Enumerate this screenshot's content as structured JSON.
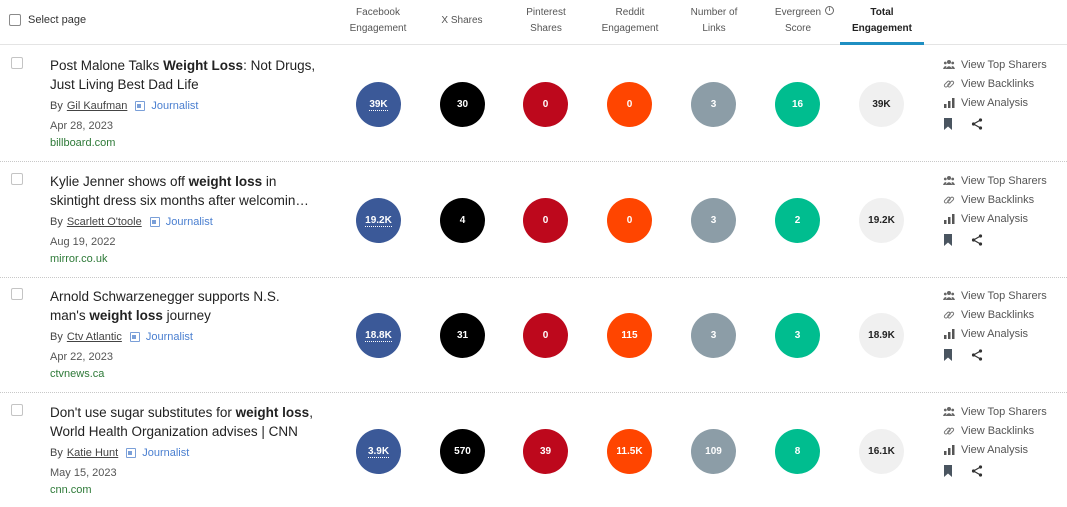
{
  "header": {
    "select_page_label": "Select page",
    "columns": [
      {
        "line1": "Facebook",
        "line2": "Engagement"
      },
      {
        "line1": "X Shares",
        "line2": ""
      },
      {
        "line1": "Pinterest",
        "line2": "Shares"
      },
      {
        "line1": "Reddit",
        "line2": "Engagement"
      },
      {
        "line1": "Number of",
        "line2": "Links"
      },
      {
        "line1": "Evergreen",
        "line2": "Score",
        "info_icon": "info-icon"
      },
      {
        "line1": "Total",
        "line2": "Engagement",
        "active": true
      }
    ]
  },
  "actions": {
    "top_sharers": "View Top Sharers",
    "backlinks": "View Backlinks",
    "analysis": "View Analysis",
    "icons": [
      "users-icon",
      "link-icon",
      "bar-chart-icon",
      "bookmark-icon",
      "share-icon"
    ]
  },
  "colors": {
    "facebook": "#3b5998",
    "x": "#000000",
    "pinterest": "#bd081c",
    "reddit": "#ff4500",
    "links": "#8c9da7",
    "evergreen": "#00bd8f",
    "total": "#f0f0f0",
    "active_tab": "#1f8fc2",
    "domain": "#2e7a38",
    "journalist": "#4a7fd0"
  },
  "rows": [
    {
      "title_pre": "Post Malone Talks ",
      "title_bold": "Weight Loss",
      "title_post": ": Not Drugs,",
      "title_line2": "Just Living Best Dad Life",
      "by": "By",
      "author": "Gil Kaufman",
      "journalist": "Journalist",
      "date": "Apr 28, 2023",
      "domain": "billboard.com",
      "facebook": "39K",
      "x_shares": "30",
      "pinterest": "0",
      "reddit": "0",
      "links": "3",
      "evergreen": "16",
      "total": "39K"
    },
    {
      "title_pre": "Kylie Jenner shows off ",
      "title_bold": "weight loss",
      "title_post": " in",
      "title_line2": "skintight dress six months after welcomin…",
      "by": "By",
      "author": "Scarlett O'toole",
      "journalist": "Journalist",
      "date": "Aug 19, 2022",
      "domain": "mirror.co.uk",
      "facebook": "19.2K",
      "x_shares": "4",
      "pinterest": "0",
      "reddit": "0",
      "links": "3",
      "evergreen": "2",
      "total": "19.2K"
    },
    {
      "title_pre": "Arnold Schwarzenegger supports N.S.",
      "title_bold": "",
      "title_post": "",
      "title_line2_pre": "man's ",
      "title_line2_bold": "weight loss",
      "title_line2_post": " journey",
      "by": "By",
      "author": "Ctv Atlantic",
      "journalist": "Journalist",
      "date": "Apr 22, 2023",
      "domain": "ctvnews.ca",
      "facebook": "18.8K",
      "x_shares": "31",
      "pinterest": "0",
      "reddit": "115",
      "links": "3",
      "evergreen": "3",
      "total": "18.9K"
    },
    {
      "title_pre": "Don't use sugar substitutes for ",
      "title_bold": "weight loss",
      "title_post": ",",
      "title_line2": "World Health Organization advises | CNN",
      "by": "By",
      "author": "Katie Hunt",
      "journalist": "Journalist",
      "date": "May 15, 2023",
      "domain": "cnn.com",
      "facebook": "3.9K",
      "x_shares": "570",
      "pinterest": "39",
      "reddit": "11.5K",
      "links": "109",
      "evergreen": "8",
      "total": "16.1K"
    }
  ]
}
